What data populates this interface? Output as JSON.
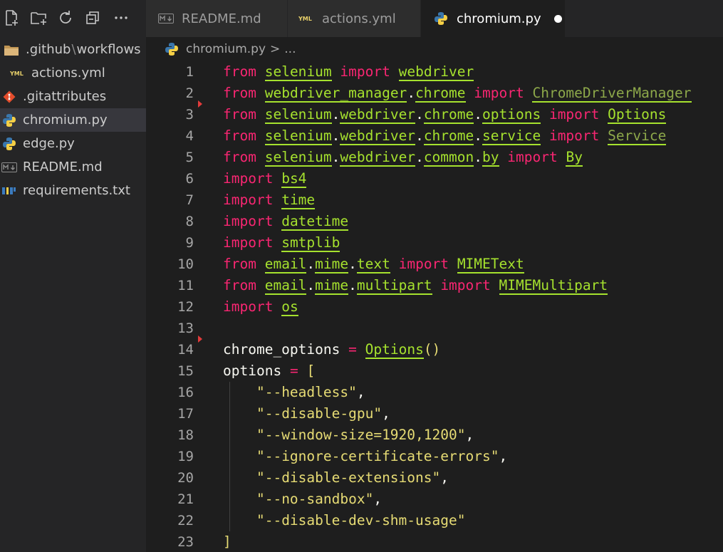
{
  "sidebar": {
    "tools": [
      "new-file-icon",
      "new-folder-icon",
      "refresh-icon",
      "collapse-all-icon",
      "more-icon"
    ],
    "items": [
      {
        "icon": "folder-icon",
        "parts": [
          ".github",
          "workflows"
        ]
      },
      {
        "icon": "yaml-file-icon",
        "label": "actions.yml"
      },
      {
        "icon": "git-file-icon",
        "label": ".gitattributes"
      },
      {
        "icon": "python-file-icon",
        "label": "chromium.py"
      },
      {
        "icon": "python-file-icon",
        "label": "edge.py"
      },
      {
        "icon": "markdown-file-icon",
        "label": "README.md"
      },
      {
        "icon": "pip-requirements-icon",
        "label": "requirements.txt"
      }
    ],
    "path_separator": "\\"
  },
  "tabs": [
    {
      "label": "README.md",
      "icon": "markdown-file-icon"
    },
    {
      "label": "actions.yml",
      "icon": "yaml-file-icon"
    },
    {
      "label": "chromium.py",
      "icon": "python-file-icon"
    }
  ],
  "breadcrumb": {
    "file": "chromium.py",
    "chevron": ">",
    "more": "..."
  },
  "editor": {
    "line_numbers": [
      "1",
      "2",
      "3",
      "4",
      "5",
      "6",
      "7",
      "8",
      "9",
      "10",
      "11",
      "12",
      "13",
      "14",
      "15",
      "16",
      "17",
      "18",
      "19",
      "20",
      "21",
      "22",
      "23"
    ],
    "code": {
      "from": "from",
      "import": "import",
      "selenium": "selenium",
      "webdriver": "webdriver",
      "webdriver_manager": "webdriver_manager",
      "chrome": "chrome",
      "ChromeDriverManager": "ChromeDriverManager",
      "options": "options",
      "Options": "Options",
      "service": "service",
      "Service": "Service",
      "common": "common",
      "by": "by",
      "By": "By",
      "bs4": "bs4",
      "time": "time",
      "datetime": "datetime",
      "smtplib": "smtplib",
      "email": "email",
      "mime": "mime",
      "text": "text",
      "MIMEText": "MIMEText",
      "multipart": "multipart",
      "MIMEMultipart": "MIMEMultipart",
      "os": "os",
      "chrome_options": "chrome_options",
      "options_var": "options",
      "eq": "=",
      "call": "()",
      "lbracket": "[",
      "rbracket": "]",
      "dot": "."
    },
    "strings": [
      "\"--headless\"",
      "\"--disable-gpu\"",
      "\"--window-size=1920,1200\"",
      "\"--ignore-certificate-errors\"",
      "\"--disable-extensions\"",
      "\"--no-sandbox\"",
      "\"--disable-dev-shm-usage\""
    ],
    "comma": ","
  },
  "colors": {
    "keyword": "#f92672",
    "identifier": "#a6e22e",
    "string": "#e6db74",
    "background": "#1e1e1e",
    "sidebar": "#252526"
  }
}
